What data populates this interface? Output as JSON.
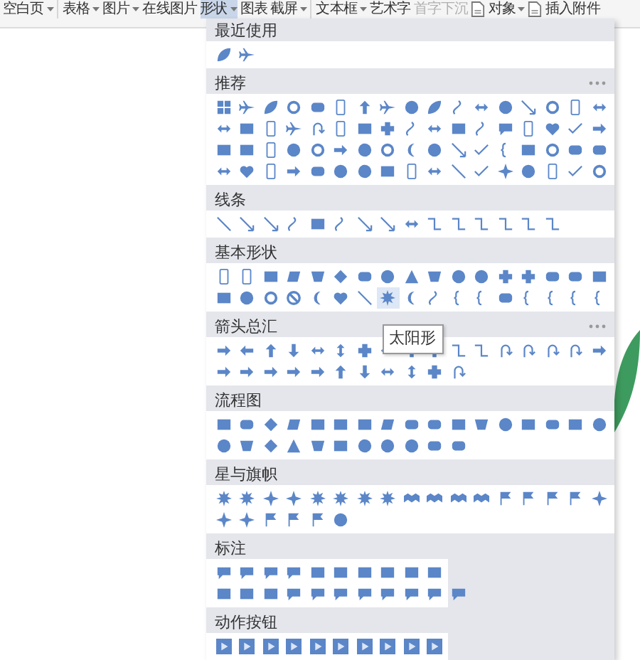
{
  "toolbar": {
    "groups": [
      [
        {
          "label": "空白页",
          "kind": "text",
          "dropdown": true,
          "selected": false,
          "disabled": false
        }
      ],
      [
        {
          "label": "表格",
          "kind": "text",
          "dropdown": true,
          "selected": false,
          "disabled": false
        },
        {
          "label": "图片",
          "kind": "text",
          "dropdown": true,
          "selected": false,
          "disabled": false
        },
        {
          "label": "在线图片",
          "kind": "text",
          "dropdown": false,
          "selected": false,
          "disabled": false
        },
        {
          "label": "形状",
          "kind": "text",
          "dropdown": true,
          "selected": true,
          "disabled": false
        },
        {
          "label": "图表",
          "kind": "text",
          "dropdown": false,
          "selected": false,
          "disabled": false
        },
        {
          "label": "截屏",
          "kind": "text",
          "dropdown": true,
          "selected": false,
          "disabled": false
        }
      ],
      [
        {
          "label": "文本框",
          "kind": "text",
          "dropdown": true,
          "selected": false,
          "disabled": false
        },
        {
          "label": "艺术字",
          "kind": "text",
          "dropdown": false,
          "selected": false,
          "disabled": false
        },
        {
          "label": "首字下沉",
          "kind": "text",
          "dropdown": false,
          "selected": false,
          "disabled": true
        },
        {
          "label": "对象",
          "kind": "icon",
          "dropdown": true,
          "selected": false,
          "disabled": false
        },
        {
          "label": "插入附件",
          "kind": "icon",
          "dropdown": false,
          "selected": false,
          "disabled": false
        }
      ]
    ]
  },
  "shape_menu": {
    "sections": [
      {
        "title": "最近使用",
        "more": false
      },
      {
        "title": "推荐",
        "more": true
      },
      {
        "title": "线条",
        "more": false
      },
      {
        "title": "基本形状",
        "more": false,
        "tooltip": "太阳形"
      },
      {
        "title": "箭头总汇",
        "more": true
      },
      {
        "title": "流程图",
        "more": false
      },
      {
        "title": "星与旗帜",
        "more": false
      },
      {
        "title": "标注",
        "more": false
      },
      {
        "title": "动作按钮",
        "more": false
      }
    ]
  }
}
